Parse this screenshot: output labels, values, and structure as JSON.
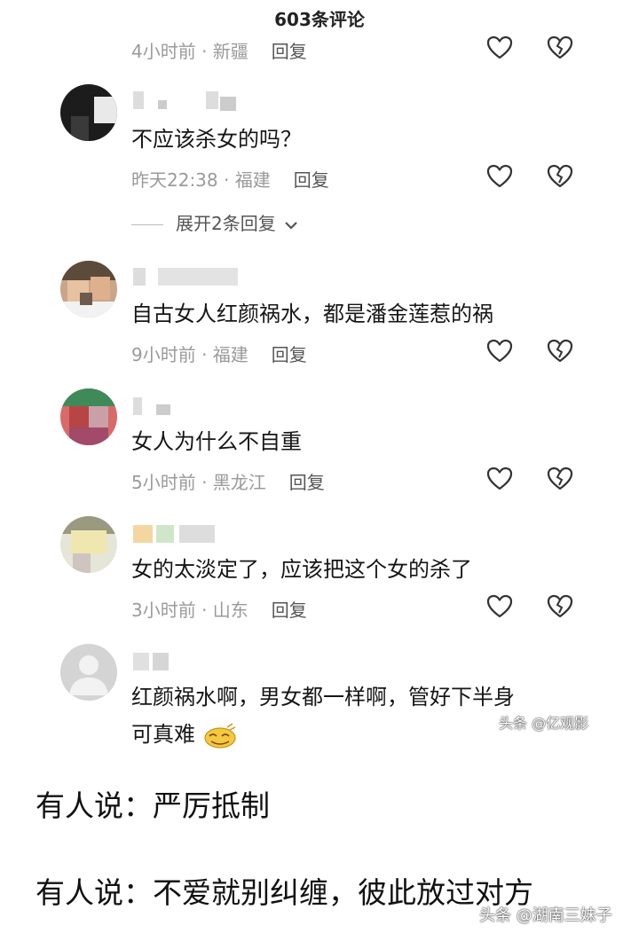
{
  "header": {
    "title": "603条评论"
  },
  "comments": [
    {
      "text": "",
      "time": "4小时前 · 新疆",
      "reply": "回复"
    },
    {
      "text": "不应该杀女的吗？",
      "time": "昨天22:38 · 福建",
      "reply": "回复",
      "expand": "展开2条回复"
    },
    {
      "text": "自古女人红颜祸水，都是潘金莲惹的祸",
      "time": "9小时前 · 福建",
      "reply": "回复"
    },
    {
      "text": "女人为什么不自重",
      "time": "5小时前 · 黑龙江",
      "reply": "回复"
    },
    {
      "text": "女的太淡定了，应该把这个女的杀了",
      "time": "3小时前 · 山东",
      "reply": "回复"
    },
    {
      "text_line1": "红颜祸水啊，男女都一样啊，管好下半身",
      "text_line2": "可真难"
    }
  ],
  "watermarks": {
    "inner": "头条 @亿观影",
    "outer": "头条 @湖南三妹子"
  },
  "article": {
    "para1": "有人说：严厉抵制",
    "para2": "有人说：不爱就别纠缠，彼此放过对方"
  },
  "colors": {
    "meta": "#9a9a9a",
    "text": "#161616",
    "icon": "#333333"
  },
  "icons": [
    "heart-icon",
    "broken-heart-icon",
    "chevron-down-icon",
    "emoji-icon"
  ]
}
